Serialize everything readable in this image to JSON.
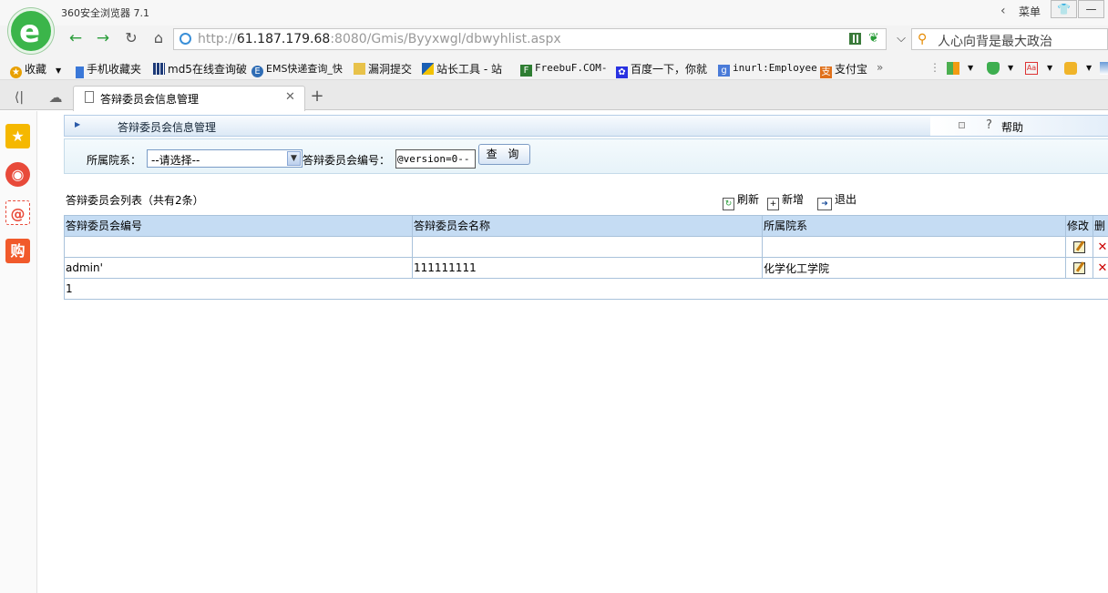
{
  "browser": {
    "app_title": "360安全浏览器 7.1",
    "menu_label": "菜单",
    "url_prefix": "http://",
    "url_host": "61.187.179.68",
    "url_rest": ":8080/Gmis/Byyxwgl/dbwyhlist.aspx",
    "search_text": "人心向背是最大政治",
    "bookmarks": [
      {
        "label": "收藏",
        "icon": "star-add-icon",
        "color": "#e8a000"
      },
      {
        "label": "手机收藏夹",
        "icon": "phone-icon",
        "color": "#3a78d8"
      },
      {
        "label": "md5在线查询破",
        "icon": "grid-icon",
        "color": "#1d3a78"
      },
      {
        "label": "EMS快递查询_快",
        "icon": "ems-icon",
        "color": "#2f6db5"
      },
      {
        "label": "漏洞提交",
        "icon": "folder-icon",
        "color": "#e8c24a"
      },
      {
        "label": "站长工具 - 站",
        "icon": "chinaz-icon",
        "color": "#1a5fb4"
      },
      {
        "label": "FreebuF.COM-",
        "icon": "freebuf-icon",
        "color": "#2e7d32"
      },
      {
        "label": "百度一下，你就",
        "icon": "baidu-paw-icon",
        "color": "#2932e1"
      },
      {
        "label": "inurl:Employee",
        "icon": "google-g-icon",
        "color": "#4a7bd8"
      },
      {
        "label": "支付宝",
        "icon": "shield-icon",
        "color": "#e0701a"
      }
    ],
    "tab_title": "答辩委员会信息管理"
  },
  "page": {
    "header_title": "答辩委员会信息管理",
    "help_label": "帮助",
    "filter": {
      "dept_label": "所属院系：",
      "dept_value": "--请选择--",
      "code_label": "答辩委员会编号：",
      "code_value": "@version=0--",
      "query_label": "查 询"
    },
    "list_title": "答辩委员会列表（共有2条）",
    "toolbar": {
      "refresh": "刷新",
      "add": "新增",
      "exit": "退出"
    },
    "table": {
      "headers": [
        "答辩委员会编号",
        "答辩委员会名称",
        "所属院系",
        "修改",
        "删"
      ],
      "rows": [
        {
          "code": "",
          "name": "",
          "dept": ""
        },
        {
          "code": "admin'",
          "name": "111111111",
          "dept": "化学化工学院"
        }
      ],
      "pager": "1"
    }
  }
}
